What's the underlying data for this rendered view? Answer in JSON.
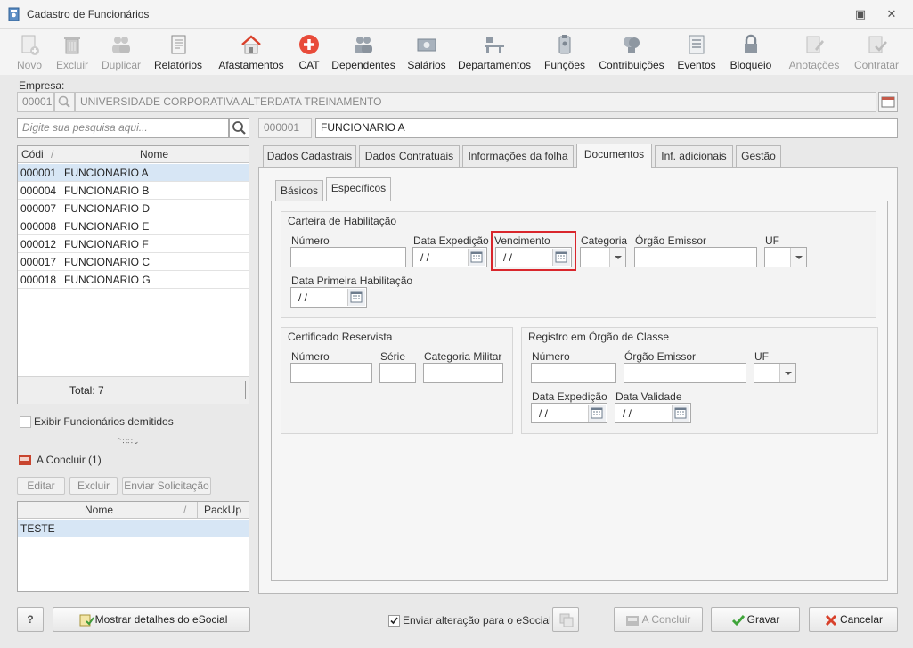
{
  "window": {
    "title": "Cadastro de Funcionários"
  },
  "toolbar": {
    "items": [
      {
        "label": "Novo",
        "icon": "new-icon",
        "enabled": false
      },
      {
        "label": "Excluir",
        "icon": "trash-icon",
        "enabled": false
      },
      {
        "label": "Duplicar",
        "icon": "duplicate-icon",
        "enabled": false
      },
      {
        "label": "Relatórios",
        "icon": "report-icon",
        "enabled": true
      },
      {
        "label": "Afastamentos",
        "icon": "house-icon",
        "enabled": true
      },
      {
        "label": "CAT",
        "icon": "cross-icon",
        "enabled": true
      },
      {
        "label": "Dependentes",
        "icon": "people-icon",
        "enabled": true
      },
      {
        "label": "Salários",
        "icon": "money-icon",
        "enabled": true
      },
      {
        "label": "Departamentos",
        "icon": "desk-icon",
        "enabled": true
      },
      {
        "label": "Funções",
        "icon": "badge-icon",
        "enabled": true
      },
      {
        "label": "Contribuições",
        "icon": "heads-icon",
        "enabled": true
      },
      {
        "label": "Eventos",
        "icon": "list-icon",
        "enabled": true
      },
      {
        "label": "Bloqueio",
        "icon": "lock-icon",
        "enabled": true
      },
      {
        "label": "Anotações",
        "icon": "note-icon",
        "enabled": false
      },
      {
        "label": "Contratar",
        "icon": "check-doc-icon",
        "enabled": false
      }
    ]
  },
  "empresa": {
    "label": "Empresa:",
    "code": "00001",
    "name": "UNIVERSIDADE CORPORATIVA ALTERDATA TREINAMENTO"
  },
  "search": {
    "placeholder": "Digite sua pesquisa aqui..."
  },
  "employee": {
    "code": "000001",
    "name": "FUNCIONARIO A"
  },
  "list": {
    "col_code": "Códi",
    "col_name": "Nome",
    "rows": [
      {
        "code": "000001",
        "name": "FUNCIONARIO A"
      },
      {
        "code": "000004",
        "name": "FUNCIONARIO B"
      },
      {
        "code": "000007",
        "name": "FUNCIONARIO D"
      },
      {
        "code": "000008",
        "name": "FUNCIONARIO E"
      },
      {
        "code": "000012",
        "name": "FUNCIONARIO F"
      },
      {
        "code": "000017",
        "name": "FUNCIONARIO C"
      },
      {
        "code": "000018",
        "name": "FUNCIONARIO G"
      }
    ],
    "total": "Total: 7"
  },
  "show_dismissed": "Exibir Funcionários demitidos",
  "pending": {
    "title": "A Concluir (1)",
    "edit": "Editar",
    "delete": "Excluir",
    "send": "Enviar Solicitação",
    "col_name": "Nome",
    "col_packup": "PackUp",
    "rows": [
      {
        "name": "TESTE",
        "packup": ""
      }
    ]
  },
  "tabs": [
    "Dados Cadastrais",
    "Dados Contratuais",
    "Informações da folha",
    "Documentos",
    "Inf. adicionais",
    "Gestão"
  ],
  "subtabs": [
    "Básicos",
    "Específicos"
  ],
  "cnh": {
    "title": "Carteira de Habilitação",
    "numero": "Número",
    "data_expedicao": "Data Expedição",
    "vencimento": "Vencimento",
    "categoria": "Categoria",
    "orgao_emissor": "Órgão Emissor",
    "uf": "UF",
    "data_primeira": "Data Primeira Habilitação",
    "date_value": "/ /"
  },
  "reservista": {
    "title": "Certificado Reservista",
    "numero": "Número",
    "serie": "Série",
    "categoria": "Categoria Militar"
  },
  "registro": {
    "title": "Registro em Órgão de Classe",
    "numero": "Número",
    "orgao_emissor": "Órgão Emissor",
    "uf": "UF",
    "data_expedicao": "Data Expedição",
    "data_validade": "Data Validade",
    "date_value": "/ /"
  },
  "footer": {
    "help": "?",
    "esocial_details": "Mostrar detalhes do eSocial",
    "send_esocial": "Enviar alteração para o eSocial",
    "conclude": "A Concluir",
    "save": "Gravar",
    "cancel": "Cancelar"
  },
  "colors": {
    "highlight": "#d9262c",
    "selection": "#d7e6f5"
  }
}
